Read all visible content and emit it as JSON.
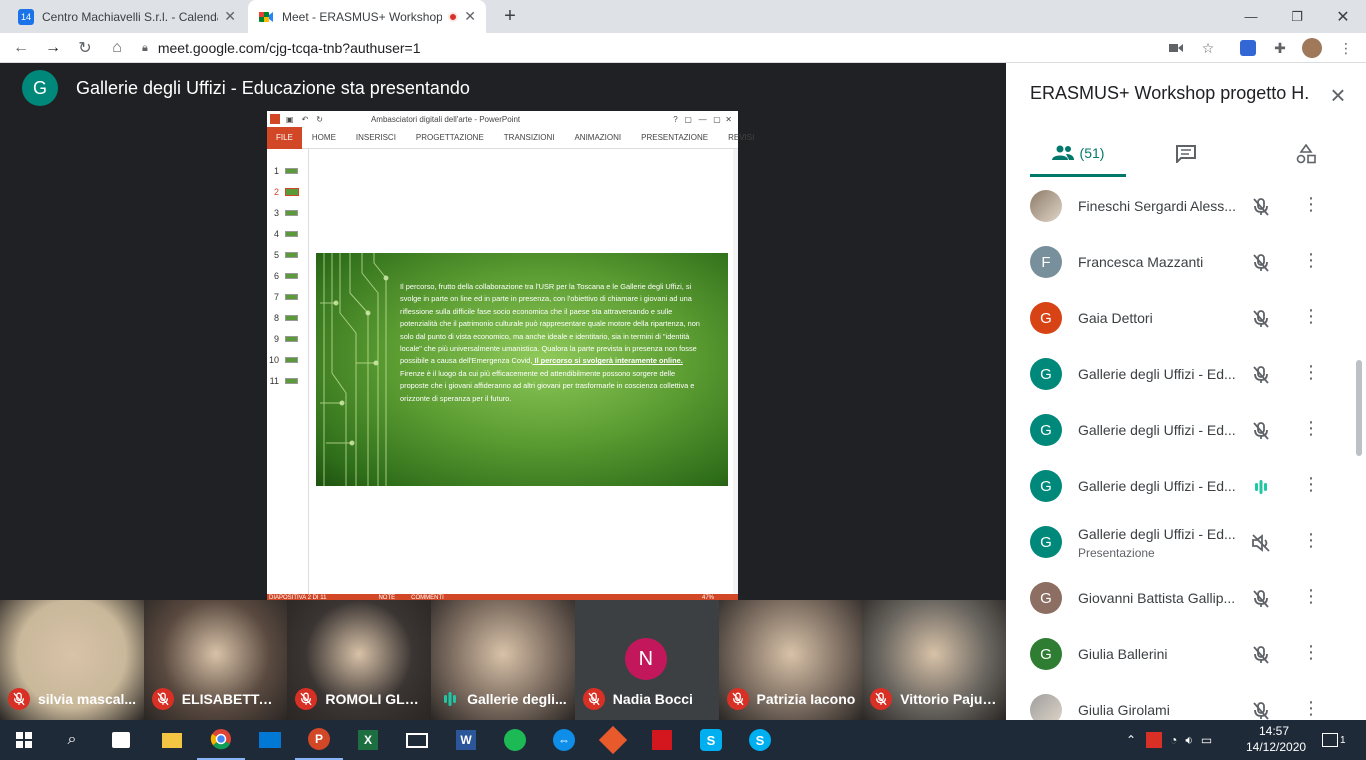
{
  "browser": {
    "tabs": [
      {
        "title": "Centro Machiavelli S.r.l. - Calendario",
        "favicon": "calendar-icon",
        "favicon_text": "14"
      },
      {
        "title": "Meet - ERASMUS+ Workshop progetto",
        "favicon": "meet-icon",
        "favicon_text": ""
      }
    ],
    "new_tab": "+",
    "url": "meet.google.com/cjg-tcqa-tnb?authuser=1"
  },
  "meet": {
    "presenter_initial": "G",
    "presenter_text": "Gallerie degli Uffizi - Educazione sta presentando",
    "accent": "#00796b"
  },
  "ppt": {
    "window_title": "Ambasciatori digitali dell'arte - PowerPoint",
    "ribbon": [
      "FILE",
      "HOME",
      "INSERISCI",
      "PROGETTAZIONE",
      "TRANSIZIONI",
      "ANIMAZIONI",
      "PRESENTAZIONE",
      "REVISI"
    ],
    "thumbnails": [
      "1",
      "2",
      "3",
      "4",
      "5",
      "6",
      "7",
      "8",
      "9",
      "10",
      "11"
    ],
    "selected_slide": 2,
    "slide_text_1": "Il percorso, frutto della collaborazione tra l'USR per la Toscana e le Gallerie degli Uffizi, si svolge in parte on line ed in parte in presenza, con l'obiettivo di  chiamare i giovani ad una riflessione sulla difficile fase socio economica che il paese sta attraversando e sulle potenzialità che il patrimonio culturale può rappresentare quale motore della ripartenza, non solo dal punto di vista economico, ma anche ideale e identitario, sia in termini di \"identità locale\" che più universalmente umanistica. Qualora la parte prevista in presenza non fosse possibile a causa dell'Emergenza Covid,",
    "slide_text_bold": " Il percorso si svolgerà interamente online.",
    "slide_text_2": "Firenze è il luogo da cui più efficacemente ed attendibilmente possono sorgere delle proposte che i giovani affideranno ad altri giovani per trasformarle in coscienza collettiva e orizzonte di speranza per il futuro.",
    "status": "DIAPOSITIVA 2 DI 11",
    "status_notes": "NOTE",
    "status_comments": "COMMENTI",
    "zoom": "47%"
  },
  "panel": {
    "title": "ERASMUS+ Workshop progetto H...",
    "people_count": "(51)",
    "participants": [
      {
        "name": "Fineschi Sergardi Aless...",
        "initial": "",
        "color": "#8d7b6a",
        "photo": true,
        "mic": "muted"
      },
      {
        "name": "Francesca Mazzanti",
        "initial": "F",
        "color": "#78909c",
        "mic": "muted"
      },
      {
        "name": "Gaia Dettori",
        "initial": "G",
        "color": "#d84315",
        "mic": "muted"
      },
      {
        "name": "Gallerie degli Uffizi - Ed...",
        "initial": "G",
        "color": "#00897b",
        "mic": "muted"
      },
      {
        "name": "Gallerie degli Uffizi - Ed...",
        "initial": "G",
        "color": "#00897b",
        "mic": "muted"
      },
      {
        "name": "Gallerie degli Uffizi - Ed...",
        "initial": "G",
        "color": "#00897b",
        "mic": "speaking"
      },
      {
        "name": "Gallerie degli Uffizi - Ed...",
        "initial": "G",
        "color": "#00897b",
        "sub": "Presentazione",
        "mic": "volume-off"
      },
      {
        "name": "Giovanni Battista Gallip...",
        "initial": "G",
        "color": "#8d6e63",
        "mic": "muted"
      },
      {
        "name": "Giulia Ballerini",
        "initial": "G",
        "color": "#2e7d32",
        "mic": "muted"
      },
      {
        "name": "Giulia Girolami",
        "initial": "",
        "color": "#9e9e9e",
        "photo": true,
        "mic": "muted"
      }
    ]
  },
  "filmstrip": [
    {
      "name": "silvia mascal...",
      "bg": "#c9b89a",
      "mic": "muted"
    },
    {
      "name": "ELISABETTA ...",
      "bg": "#5a4a40",
      "mic": "muted"
    },
    {
      "name": "ROMOLI GLO...",
      "bg": "#3a3432",
      "mic": "muted"
    },
    {
      "name": "Gallerie degli...",
      "bg": "#7a6a5e",
      "mic": "speaking"
    },
    {
      "name": "Nadia Bocci",
      "bg": "#3c4043",
      "initial": "N",
      "avatar_color": "#c2185b",
      "mic": "muted"
    },
    {
      "name": "Patrizia Iacono",
      "bg": "#7b6c60",
      "mic": "muted"
    },
    {
      "name": "Vittorio Pajus...",
      "bg": "#6a6660",
      "mic": "muted"
    }
  ],
  "taskbar": {
    "time": "14:57",
    "date": "14/12/2020",
    "notifications": "1"
  }
}
